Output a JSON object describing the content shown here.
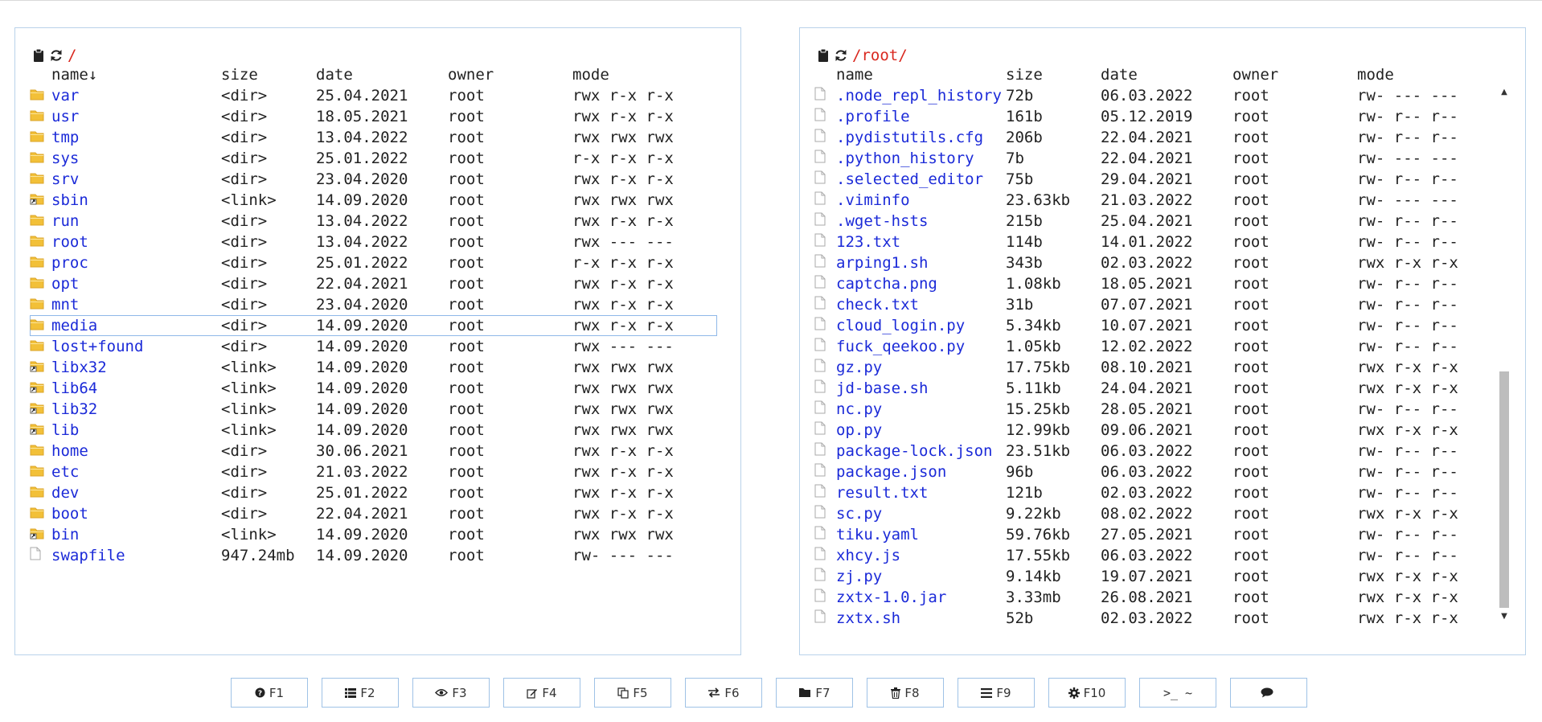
{
  "colors": {
    "path": "#d9281f",
    "link": "#1b2ad8",
    "border": "#b9d2ea",
    "selection": "#8fb8e8",
    "folder": "#f2c038",
    "folder_dark": "#dba52a",
    "scroll_thumb": "#bdbdbd"
  },
  "left": {
    "path": "/",
    "headers": {
      "name": "name↓",
      "size": "size",
      "date": "date",
      "owner": "owner",
      "mode": "mode"
    },
    "files": [
      {
        "icon": "folder-icon",
        "name": "var",
        "size": "<dir>",
        "date": "25.04.2021",
        "owner": "root",
        "mode": "rwx r-x r-x"
      },
      {
        "icon": "folder-icon",
        "name": "usr",
        "size": "<dir>",
        "date": "18.05.2021",
        "owner": "root",
        "mode": "rwx r-x r-x"
      },
      {
        "icon": "folder-icon",
        "name": "tmp",
        "size": "<dir>",
        "date": "13.04.2022",
        "owner": "root",
        "mode": "rwx rwx rwx"
      },
      {
        "icon": "folder-icon",
        "name": "sys",
        "size": "<dir>",
        "date": "25.01.2022",
        "owner": "root",
        "mode": "r-x r-x r-x"
      },
      {
        "icon": "folder-icon",
        "name": "srv",
        "size": "<dir>",
        "date": "23.04.2020",
        "owner": "root",
        "mode": "rwx r-x r-x"
      },
      {
        "icon": "folder-link-icon",
        "name": "sbin",
        "size": "<link>",
        "date": "14.09.2020",
        "owner": "root",
        "mode": "rwx rwx rwx"
      },
      {
        "icon": "folder-icon",
        "name": "run",
        "size": "<dir>",
        "date": "13.04.2022",
        "owner": "root",
        "mode": "rwx r-x r-x"
      },
      {
        "icon": "folder-icon",
        "name": "root",
        "size": "<dir>",
        "date": "13.04.2022",
        "owner": "root",
        "mode": "rwx --- ---"
      },
      {
        "icon": "folder-icon",
        "name": "proc",
        "size": "<dir>",
        "date": "25.01.2022",
        "owner": "root",
        "mode": "r-x r-x r-x"
      },
      {
        "icon": "folder-icon",
        "name": "opt",
        "size": "<dir>",
        "date": "22.04.2021",
        "owner": "root",
        "mode": "rwx r-x r-x"
      },
      {
        "icon": "folder-icon",
        "name": "mnt",
        "size": "<dir>",
        "date": "23.04.2020",
        "owner": "root",
        "mode": "rwx r-x r-x"
      },
      {
        "icon": "folder-icon",
        "name": "media",
        "size": "<dir>",
        "date": "14.09.2020",
        "owner": "root",
        "mode": "rwx r-x r-x",
        "selected": true
      },
      {
        "icon": "folder-icon",
        "name": "lost+found",
        "size": "<dir>",
        "date": "14.09.2020",
        "owner": "root",
        "mode": "rwx --- ---"
      },
      {
        "icon": "folder-link-icon",
        "name": "libx32",
        "size": "<link>",
        "date": "14.09.2020",
        "owner": "root",
        "mode": "rwx rwx rwx"
      },
      {
        "icon": "folder-link-icon",
        "name": "lib64",
        "size": "<link>",
        "date": "14.09.2020",
        "owner": "root",
        "mode": "rwx rwx rwx"
      },
      {
        "icon": "folder-link-icon",
        "name": "lib32",
        "size": "<link>",
        "date": "14.09.2020",
        "owner": "root",
        "mode": "rwx rwx rwx"
      },
      {
        "icon": "folder-link-icon",
        "name": "lib",
        "size": "<link>",
        "date": "14.09.2020",
        "owner": "root",
        "mode": "rwx rwx rwx"
      },
      {
        "icon": "folder-icon",
        "name": "home",
        "size": "<dir>",
        "date": "30.06.2021",
        "owner": "root",
        "mode": "rwx r-x r-x"
      },
      {
        "icon": "folder-icon",
        "name": "etc",
        "size": "<dir>",
        "date": "21.03.2022",
        "owner": "root",
        "mode": "rwx r-x r-x"
      },
      {
        "icon": "folder-icon",
        "name": "dev",
        "size": "<dir>",
        "date": "25.01.2022",
        "owner": "root",
        "mode": "rwx r-x r-x"
      },
      {
        "icon": "folder-icon",
        "name": "boot",
        "size": "<dir>",
        "date": "22.04.2021",
        "owner": "root",
        "mode": "rwx r-x r-x"
      },
      {
        "icon": "folder-link-icon",
        "name": "bin",
        "size": "<link>",
        "date": "14.09.2020",
        "owner": "root",
        "mode": "rwx rwx rwx"
      },
      {
        "icon": "file-icon",
        "name": "swapfile",
        "size": "947.24mb",
        "date": "14.09.2020",
        "owner": "root",
        "mode": "rw- --- ---"
      }
    ]
  },
  "right": {
    "path": "/root/",
    "headers": {
      "name": "name",
      "size": "size",
      "date": "date",
      "owner": "owner",
      "mode": "mode"
    },
    "files": [
      {
        "icon": "file-icon",
        "name": ".node_repl_history",
        "size": "72b",
        "date": "06.03.2022",
        "owner": "root",
        "mode": "rw- --- ---"
      },
      {
        "icon": "file-icon",
        "name": ".profile",
        "size": "161b",
        "date": "05.12.2019",
        "owner": "root",
        "mode": "rw- r-- r--"
      },
      {
        "icon": "file-icon",
        "name": ".pydistutils.cfg",
        "size": "206b",
        "date": "22.04.2021",
        "owner": "root",
        "mode": "rw- r-- r--"
      },
      {
        "icon": "file-icon",
        "name": ".python_history",
        "size": "7b",
        "date": "22.04.2021",
        "owner": "root",
        "mode": "rw- --- ---"
      },
      {
        "icon": "file-icon",
        "name": ".selected_editor",
        "size": "75b",
        "date": "29.04.2021",
        "owner": "root",
        "mode": "rw- r-- r--"
      },
      {
        "icon": "file-icon",
        "name": ".viminfo",
        "size": "23.63kb",
        "date": "21.03.2022",
        "owner": "root",
        "mode": "rw- --- ---"
      },
      {
        "icon": "file-icon",
        "name": ".wget-hsts",
        "size": "215b",
        "date": "25.04.2021",
        "owner": "root",
        "mode": "rw- r-- r--"
      },
      {
        "icon": "file-icon",
        "name": "123.txt",
        "size": "114b",
        "date": "14.01.2022",
        "owner": "root",
        "mode": "rw- r-- r--"
      },
      {
        "icon": "file-icon",
        "name": "arping1.sh",
        "size": "343b",
        "date": "02.03.2022",
        "owner": "root",
        "mode": "rwx r-x r-x"
      },
      {
        "icon": "file-icon",
        "name": "captcha.png",
        "size": "1.08kb",
        "date": "18.05.2021",
        "owner": "root",
        "mode": "rw- r-- r--"
      },
      {
        "icon": "file-icon",
        "name": "check.txt",
        "size": "31b",
        "date": "07.07.2021",
        "owner": "root",
        "mode": "rw- r-- r--"
      },
      {
        "icon": "file-icon",
        "name": "cloud_login.py",
        "size": "5.34kb",
        "date": "10.07.2021",
        "owner": "root",
        "mode": "rw- r-- r--"
      },
      {
        "icon": "file-icon",
        "name": "fuck_qeekoo.py",
        "size": "1.05kb",
        "date": "12.02.2022",
        "owner": "root",
        "mode": "rw- r-- r--"
      },
      {
        "icon": "file-icon",
        "name": "gz.py",
        "size": "17.75kb",
        "date": "08.10.2021",
        "owner": "root",
        "mode": "rwx r-x r-x"
      },
      {
        "icon": "file-icon",
        "name": "jd-base.sh",
        "size": "5.11kb",
        "date": "24.04.2021",
        "owner": "root",
        "mode": "rwx r-x r-x"
      },
      {
        "icon": "file-icon",
        "name": "nc.py",
        "size": "15.25kb",
        "date": "28.05.2021",
        "owner": "root",
        "mode": "rw- r-- r--"
      },
      {
        "icon": "file-icon",
        "name": "op.py",
        "size": "12.99kb",
        "date": "09.06.2021",
        "owner": "root",
        "mode": "rwx r-x r-x"
      },
      {
        "icon": "file-icon",
        "name": "package-lock.json",
        "size": "23.51kb",
        "date": "06.03.2022",
        "owner": "root",
        "mode": "rw- r-- r--"
      },
      {
        "icon": "file-icon",
        "name": "package.json",
        "size": "96b",
        "date": "06.03.2022",
        "owner": "root",
        "mode": "rw- r-- r--"
      },
      {
        "icon": "file-icon",
        "name": "result.txt",
        "size": "121b",
        "date": "02.03.2022",
        "owner": "root",
        "mode": "rw- r-- r--"
      },
      {
        "icon": "file-icon",
        "name": "sc.py",
        "size": "9.22kb",
        "date": "08.02.2022",
        "owner": "root",
        "mode": "rwx r-x r-x"
      },
      {
        "icon": "file-icon",
        "name": "tiku.yaml",
        "size": "59.76kb",
        "date": "27.05.2021",
        "owner": "root",
        "mode": "rw- r-- r--"
      },
      {
        "icon": "file-icon",
        "name": "xhcy.js",
        "size": "17.55kb",
        "date": "06.03.2022",
        "owner": "root",
        "mode": "rw- r-- r--"
      },
      {
        "icon": "file-icon",
        "name": "zj.py",
        "size": "9.14kb",
        "date": "19.07.2021",
        "owner": "root",
        "mode": "rwx r-x r-x"
      },
      {
        "icon": "file-icon",
        "name": "zxtx-1.0.jar",
        "size": "3.33mb",
        "date": "26.08.2021",
        "owner": "root",
        "mode": "rwx r-x r-x"
      },
      {
        "icon": "file-icon",
        "name": "zxtx.sh",
        "size": "52b",
        "date": "02.03.2022",
        "owner": "root",
        "mode": "rwx r-x r-x"
      }
    ]
  },
  "fkeys": [
    {
      "label": "F1",
      "icon": "question-circle-icon",
      "name": "f1-help-button"
    },
    {
      "label": "F2",
      "icon": "list-icon",
      "name": "f2-menu-button"
    },
    {
      "label": "F3",
      "icon": "eye-icon",
      "name": "f3-view-button"
    },
    {
      "label": "F4",
      "icon": "edit-icon",
      "name": "f4-edit-button"
    },
    {
      "label": "F5",
      "icon": "copy-icon",
      "name": "f5-copy-button"
    },
    {
      "label": "F6",
      "icon": "move-icon",
      "name": "f6-move-button"
    },
    {
      "label": "F7",
      "icon": "folder-new-icon",
      "name": "f7-mkdir-button"
    },
    {
      "label": "F8",
      "icon": "trash-icon",
      "name": "f8-delete-button"
    },
    {
      "label": "F9",
      "icon": "menu-icon",
      "name": "f9-menu-button"
    },
    {
      "label": "F10",
      "icon": "gear-icon",
      "name": "f10-config-button"
    },
    {
      "label": ">_ ~",
      "icon": "",
      "name": "terminal-button"
    },
    {
      "label": "",
      "icon": "chat-icon",
      "name": "chat-button"
    }
  ]
}
